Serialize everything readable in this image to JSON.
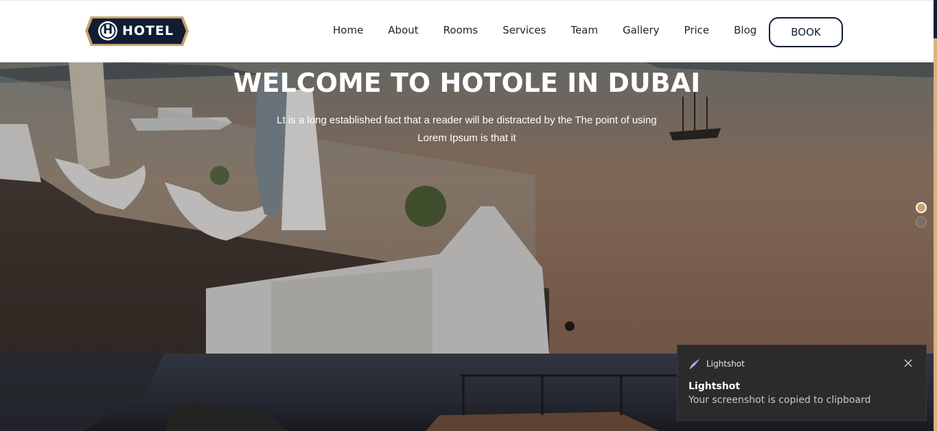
{
  "brand": {
    "logo_text": "HOTEL",
    "logo_mark": "H"
  },
  "nav": {
    "items": [
      {
        "label": "Home"
      },
      {
        "label": "About"
      },
      {
        "label": "Rooms"
      },
      {
        "label": "Services"
      },
      {
        "label": "Team"
      },
      {
        "label": "Gallery"
      },
      {
        "label": "Price"
      },
      {
        "label": "Blog"
      }
    ],
    "book_label": "BOOK"
  },
  "hero": {
    "title": "WELCOME TO HOTOLE IN DUBAI",
    "subtitle": "Lt is a long established fact that a reader will be distracted by the The point of using Lorem Ipsum is that it",
    "slides": {
      "count": 2,
      "active_index": 0
    }
  },
  "toast": {
    "app_name": "Lightshot",
    "title": "Lightshot",
    "message": "Your screenshot is copied to clipboard",
    "app_icon": "feather-icon",
    "close_icon": "close-icon"
  },
  "colors": {
    "navy": "#0f1d33",
    "accent_gold": "#d6b283",
    "dot_active": "#c9a06a",
    "toast_bg": "#2b2b2b"
  }
}
